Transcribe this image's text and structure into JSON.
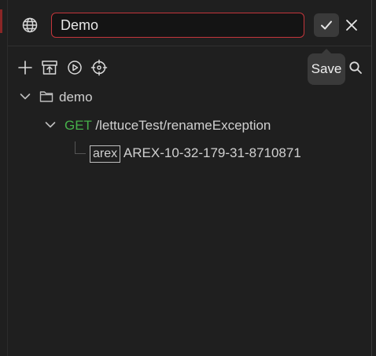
{
  "header": {
    "name_value": "Demo",
    "icons": {
      "globe": "globe-icon",
      "confirm": "check-icon",
      "close": "close-icon"
    }
  },
  "toolbar": {
    "icons": [
      "plus-icon",
      "archive-upload-icon",
      "play-circle-icon",
      "crosshair-icon",
      "search-icon"
    ],
    "tooltip": "Save"
  },
  "tree": {
    "folder": {
      "label": "demo"
    },
    "request": {
      "method": "GET",
      "path": "/lettuceTest/renameException"
    },
    "case": {
      "tag": "arex",
      "label": "AREX-10-32-179-31-8710871"
    }
  },
  "colors": {
    "background": "#1f1f1f",
    "input_border": "#c4363b",
    "method_get": "#46b04a",
    "tooltip_bg": "#3a3a3a"
  }
}
